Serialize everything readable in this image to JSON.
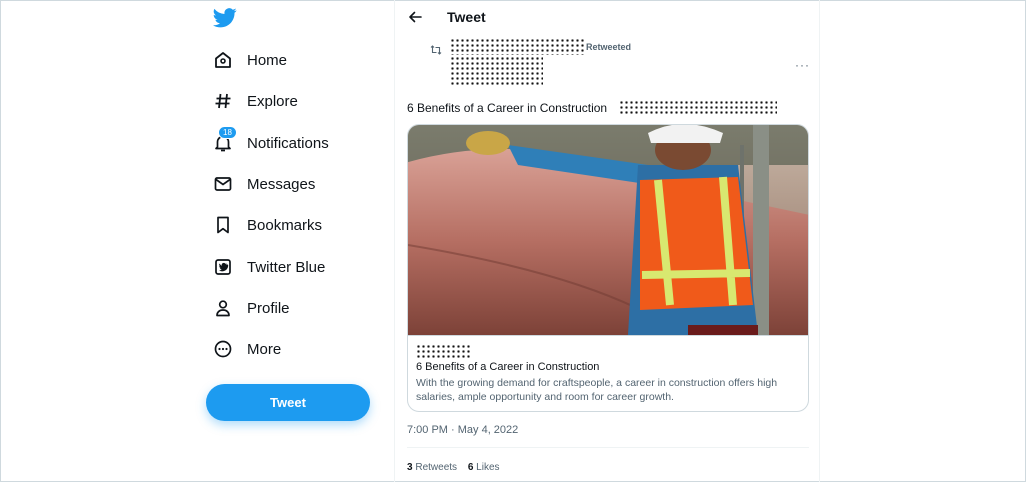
{
  "colors": {
    "accent": "#1d9bf0",
    "text": "#0f1419",
    "muted": "#536471",
    "border": "#cfd9de"
  },
  "sidebar": {
    "logo_icon": "twitter-bird-icon",
    "items": [
      {
        "label": "Home",
        "icon": "home-icon"
      },
      {
        "label": "Explore",
        "icon": "hashtag-icon"
      },
      {
        "label": "Notifications",
        "icon": "bell-icon",
        "badge": "18"
      },
      {
        "label": "Messages",
        "icon": "envelope-icon"
      },
      {
        "label": "Bookmarks",
        "icon": "bookmark-icon"
      },
      {
        "label": "Twitter Blue",
        "icon": "twitter-blue-icon"
      },
      {
        "label": "Profile",
        "icon": "person-icon"
      },
      {
        "label": "More",
        "icon": "more-circle-icon"
      }
    ],
    "tweet_button": "Tweet"
  },
  "header": {
    "title": "Tweet",
    "back_icon": "back-arrow-icon"
  },
  "tweet": {
    "retweet_label": "Retweeted",
    "more_label": "···",
    "text": "6 Benefits of a Career in Construction",
    "card": {
      "image_icon": "construction-worker-photo",
      "title": "6 Benefits of a Career in Construction",
      "description": "With the growing demand for craftspeople, a career in construction offers high salaries, ample opportunity and room for career growth."
    },
    "timestamp": "7:00 PM · May 4, 2022",
    "stats": {
      "retweets_count": "3",
      "retweets_label": "Retweets",
      "likes_count": "6",
      "likes_label": "Likes"
    }
  }
}
